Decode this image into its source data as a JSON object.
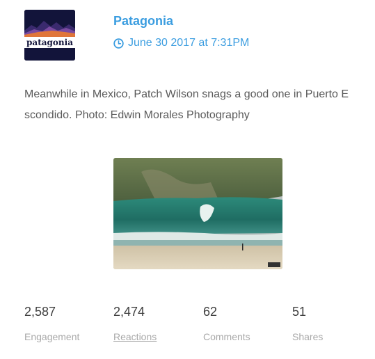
{
  "post": {
    "author": "Patagonia",
    "logo_text": "patagonia",
    "timestamp": "June 30 2017 at 7:31PM",
    "text": "Meanwhile in Mexico, Patch Wilson snags a good one in Puerto Escondido. Photo: Edwin Morales Photography",
    "photo_alt": "Surfer riding a wave at Puerto Escondido"
  },
  "stats": [
    {
      "value": "2,587",
      "label": "Engagement"
    },
    {
      "value": "2,474",
      "label": "Reactions"
    },
    {
      "value": "62",
      "label": "Comments"
    },
    {
      "value": "51",
      "label": "Shares"
    }
  ],
  "icons": {
    "timestamp": "clock-icon"
  },
  "colors": {
    "accent": "#3b9de0",
    "logo_bg": "#141633"
  }
}
